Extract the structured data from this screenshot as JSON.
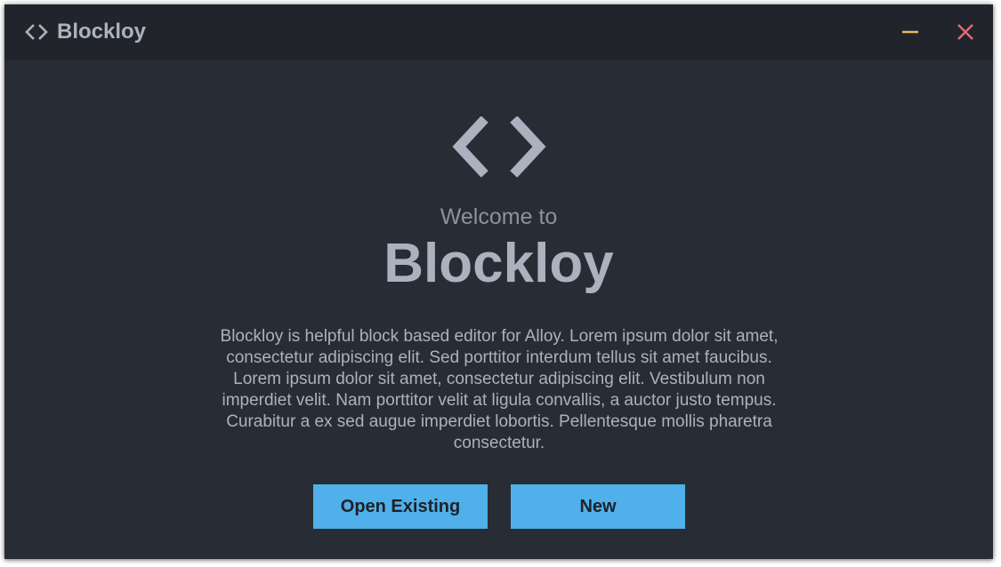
{
  "titlebar": {
    "logo_icon": "code-brackets-icon",
    "title": "Blockloy",
    "minimize_icon": "minimize-icon",
    "close_icon": "close-icon"
  },
  "main": {
    "logo_icon": "code-brackets-icon",
    "welcome_text": "Welcome to",
    "app_name": "Blockloy",
    "description": "Blockloy is helpful block based editor for Alloy. Lorem ipsum dolor sit amet, consectetur adipiscing elit. Sed porttitor interdum tellus sit amet faucibus. Lorem ipsum dolor sit amet, consectetur adipiscing elit. Vestibulum non imperdiet velit. Nam porttitor velit at ligula convallis, a auctor justo tempus. Curabitur a ex sed augue imperdiet lobortis. Pellentesque mollis pharetra consectetur.",
    "open_existing_label": "Open Existing",
    "new_label": "New"
  },
  "colors": {
    "background": "#282c34",
    "titlebar": "#21252b",
    "text": "#abb2bf",
    "accent_button": "#4fb0ea",
    "minimize": "#e5b95c",
    "close": "#e06c75"
  }
}
